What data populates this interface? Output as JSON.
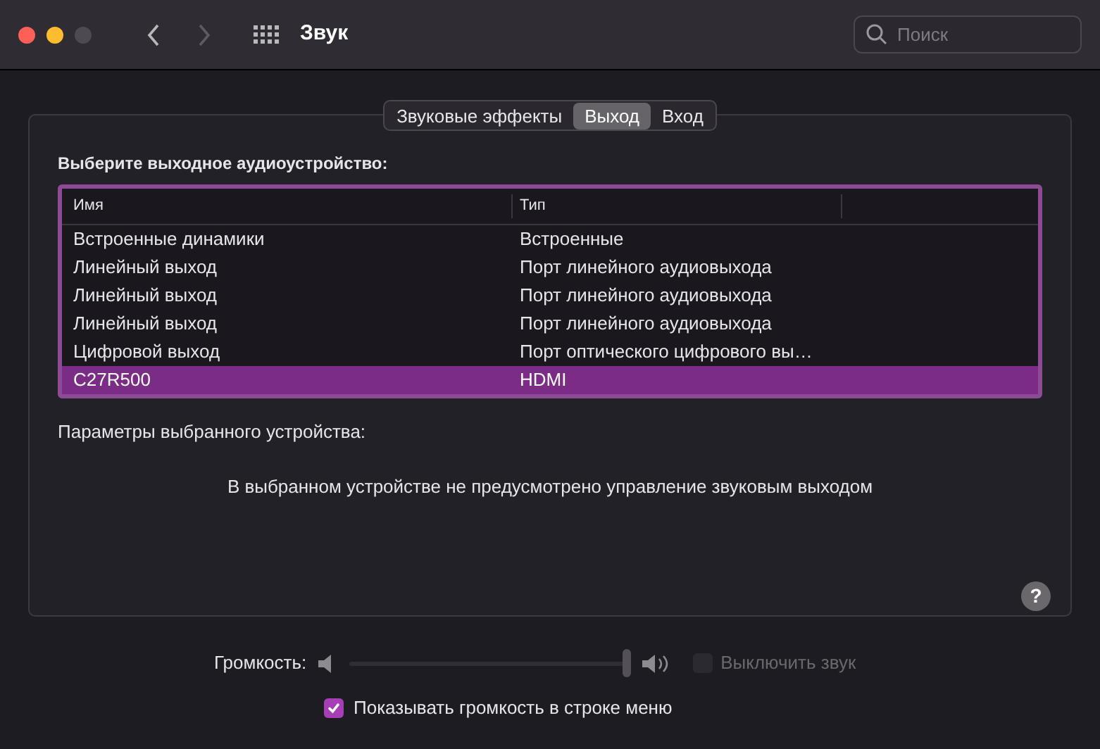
{
  "window": {
    "title": "Звук"
  },
  "search": {
    "placeholder": "Поиск"
  },
  "help": {
    "label": "?"
  },
  "tabs": [
    {
      "label": "Звуковые эффекты",
      "selected": false
    },
    {
      "label": "Выход",
      "selected": true
    },
    {
      "label": "Вход",
      "selected": false
    }
  ],
  "device_list": {
    "label": "Выберите выходное аудиоустройство:",
    "columns": [
      "Имя",
      "Тип"
    ],
    "rows": [
      {
        "name": "Встроенные динамики",
        "type": "Встроенные",
        "selected": false
      },
      {
        "name": "Линейный выход",
        "type": "Порт линейного аудиовыхода",
        "selected": false
      },
      {
        "name": "Линейный выход",
        "type": "Порт линейного аудиовыхода",
        "selected": false
      },
      {
        "name": "Линейный выход",
        "type": "Порт линейного аудиовыхода",
        "selected": false
      },
      {
        "name": "Цифровой выход",
        "type": "Порт оптического цифрового вы…",
        "selected": false
      },
      {
        "name": "C27R500",
        "type": "HDMI",
        "selected": true
      }
    ]
  },
  "device_settings": {
    "label": "Параметры выбранного устройства:",
    "message": "В выбранном устройстве не предусмотрено управление звуковым выходом"
  },
  "volume": {
    "label": "Громкость:",
    "level": 1,
    "disabled": true
  },
  "mute": {
    "label": "Выключить звук",
    "checked": false,
    "disabled": true
  },
  "show_in_menu": {
    "label": "Показывать громкость в строке меню",
    "checked": true
  }
}
